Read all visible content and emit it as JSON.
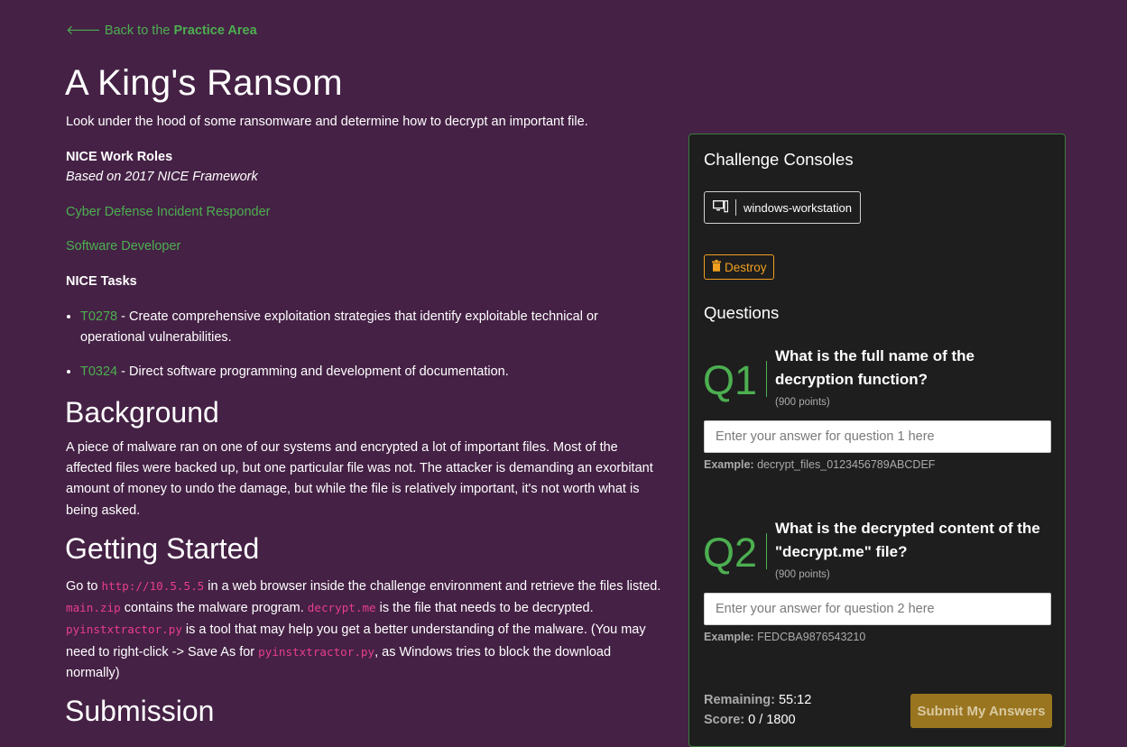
{
  "back_link": {
    "prefix": "Back to the",
    "target": "Practice Area"
  },
  "title": "A King's Ransom",
  "subtitle": "Look under the hood of some ransomware and determine how to decrypt an important file.",
  "nice": {
    "roles_heading": "NICE Work Roles",
    "framework_note": "Based on 2017 NICE Framework",
    "roles": [
      "Cyber Defense Incident Responder",
      "Software Developer"
    ],
    "tasks_heading": "NICE Tasks",
    "tasks": [
      {
        "id": "T0278",
        "text": " - Create comprehensive exploitation strategies that identify exploitable technical or operational vulnerabilities."
      },
      {
        "id": "T0324",
        "text": " - Direct software programming and development of documentation."
      }
    ]
  },
  "background": {
    "heading": "Background",
    "text": "A piece of malware ran on one of our systems and encrypted a lot of important files. Most of the affected files were backed up, but one particular file was not. The attacker is demanding an exorbitant amount of money to undo the damage, but while the file is relatively important, it's not worth what is being asked."
  },
  "getting_started": {
    "heading": "Getting Started",
    "t1": "Go to ",
    "c1": "http://10.5.5.5",
    "t2": " in a web browser inside the challenge environment and retrieve the files listed. ",
    "c2": "main.zip",
    "t3": " contains the malware program. ",
    "c3": "decrypt.me",
    "t4": " is the file that needs to be decrypted. ",
    "c4": "pyinstxtractor.py",
    "t5": " is a tool that may help you get a better understanding of the malware. (You may need to right-click -> Save As for ",
    "c5": "pyinstxtractor.py",
    "t6": ", as Windows tries to block the download normally)"
  },
  "submission_heading": "Submission",
  "panel": {
    "consoles_heading": "Challenge Consoles",
    "console_name": "windows-workstation",
    "destroy_label": "Destroy",
    "questions_heading": "Questions",
    "questions": [
      {
        "num": "Q1",
        "text": "What is the full name of the decryption function?",
        "points": "(900 points)",
        "placeholder": "Enter your answer for question 1 here",
        "example_label": "Example:",
        "example": " decrypt_files_0123456789ABCDEF"
      },
      {
        "num": "Q2",
        "text": "What is the decrypted content of the \"decrypt.me\" file?",
        "points": "(900 points)",
        "placeholder": "Enter your answer for question 2 here",
        "example_label": "Example:",
        "example": " FEDCBA9876543210"
      }
    ],
    "remaining_label": "Remaining:",
    "remaining_value": "55:12",
    "score_label": "Score:",
    "score_value": "0 / 1800",
    "submit_label": "Submit My Answers"
  },
  "colors": {
    "background": "#452145",
    "accent_green": "#4caf50",
    "panel": "#1e1e1e",
    "warning": "#f0a020",
    "code": "#e83e8c"
  }
}
